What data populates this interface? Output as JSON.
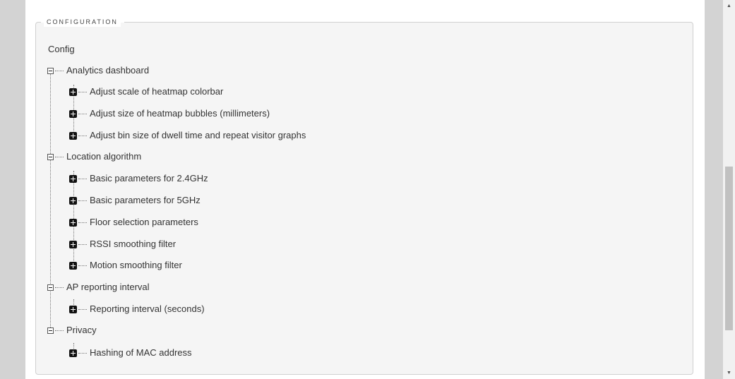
{
  "panel": {
    "legend": "CONFIGURATION",
    "root_label": "Config"
  },
  "tree": [
    {
      "label": "Analytics dashboard",
      "expanded": true,
      "children": [
        {
          "label": "Adjust scale of heatmap colorbar"
        },
        {
          "label": "Adjust size of heatmap bubbles (millimeters)"
        },
        {
          "label": "Adjust bin size of dwell time and repeat visitor graphs"
        }
      ]
    },
    {
      "label": "Location algorithm",
      "expanded": true,
      "children": [
        {
          "label": "Basic parameters for 2.4GHz"
        },
        {
          "label": "Basic parameters for 5GHz"
        },
        {
          "label": "Floor selection parameters"
        },
        {
          "label": "RSSI smoothing filter"
        },
        {
          "label": "Motion smoothing filter"
        }
      ]
    },
    {
      "label": "AP reporting interval",
      "expanded": true,
      "children": [
        {
          "label": "Reporting interval (seconds)"
        }
      ]
    },
    {
      "label": "Privacy",
      "expanded": true,
      "children": [
        {
          "label": "Hashing of MAC address"
        }
      ]
    }
  ],
  "icons": {
    "expanded": "minus-square-icon",
    "collapsed": "plus-square-icon",
    "scroll_up": "triangle-up-icon",
    "scroll_down": "triangle-down-icon"
  },
  "colors": {
    "panel_bg": "#f5f5f5",
    "gutter": "#d3d3d3",
    "text": "#333333"
  }
}
